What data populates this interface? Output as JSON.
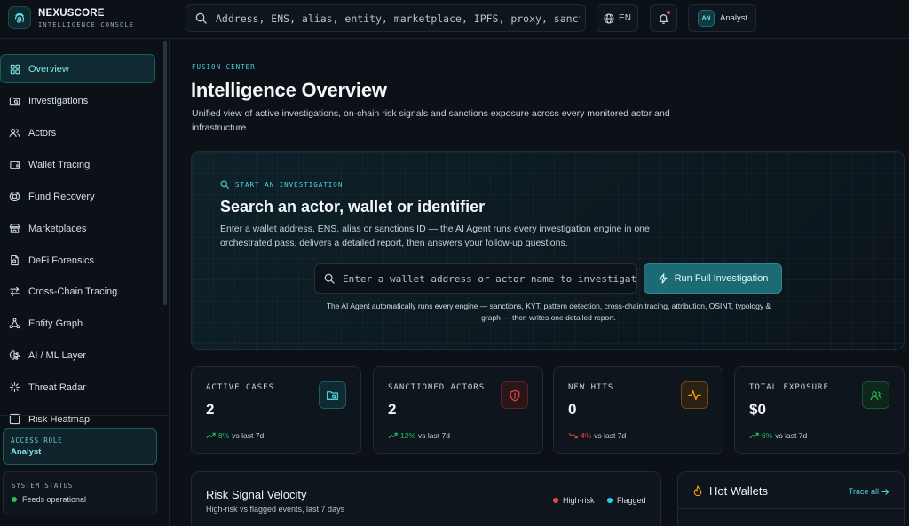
{
  "app": {
    "name": "NEXUSCORE",
    "subtitle": "INTELLIGENCE CONSOLE",
    "search_placeholder": "Address, ENS, alias, entity, marketplace, IPFS, proxy, sanctions ID",
    "language": "EN",
    "user": {
      "initials": "AN",
      "label": "Analyst"
    }
  },
  "sidebar": {
    "items": [
      {
        "label": "Overview",
        "icon": "grid-icon",
        "active": true
      },
      {
        "label": "Investigations",
        "icon": "folder-search-icon"
      },
      {
        "label": "Actors",
        "icon": "users-icon"
      },
      {
        "label": "Wallet Tracing",
        "icon": "wallet-icon"
      },
      {
        "label": "Fund Recovery",
        "icon": "lifebuoy-icon"
      },
      {
        "label": "Marketplaces",
        "icon": "store-icon"
      },
      {
        "label": "DeFi Forensics",
        "icon": "file-search-icon"
      },
      {
        "label": "Cross-Chain Tracing",
        "icon": "arrows-exchange-icon"
      },
      {
        "label": "Entity Graph",
        "icon": "network-icon"
      },
      {
        "label": "AI / ML Layer",
        "icon": "brain-icon"
      },
      {
        "label": "Threat Radar",
        "icon": "radar-icon"
      },
      {
        "label": "Risk Heatmap",
        "icon": "heatmap-icon"
      }
    ],
    "access_role": {
      "label": "ACCESS ROLE",
      "value": "Analyst"
    },
    "system_status": {
      "label": "SYSTEM STATUS",
      "value": "Feeds operational"
    }
  },
  "header": {
    "eyebrow": "FUSION CENTER",
    "title": "Intelligence Overview",
    "description": "Unified view of active investigations, on-chain risk signals and sanctions exposure across every monitored actor and infrastructure."
  },
  "hero": {
    "eyebrow": "START AN INVESTIGATION",
    "title": "Search an actor, wallet or identifier",
    "description": "Enter a wallet address, ENS, alias or sanctions ID — the AI Agent runs every investigation engine in one orchestrated pass, delivers a detailed report, then answers your follow-up questions.",
    "input_placeholder": "Enter a wallet address or actor name to investigate…",
    "button_label": "Run Full Investigation",
    "note": "The AI Agent automatically runs every engine — sanctions, KYT, pattern detection, cross-chain tracing, attribution, OSINT, typology & graph — then writes one detailed report."
  },
  "stats": [
    {
      "label": "ACTIVE CASES",
      "value": "2",
      "delta": "8%",
      "delta_suffix": "vs last 7d",
      "trend": "up",
      "icon": "folder-search-icon",
      "accent": "#4fd1dc"
    },
    {
      "label": "SANCTIONED ACTORS",
      "value": "2",
      "delta": "12%",
      "delta_suffix": "vs last 7d",
      "trend": "up",
      "icon": "shield-alert-icon",
      "accent": "#ef4444"
    },
    {
      "label": "NEW HITS",
      "value": "0",
      "delta": "4%",
      "delta_suffix": "vs last 7d",
      "trend": "down",
      "icon": "activity-icon",
      "accent": "#f59e0b"
    },
    {
      "label": "TOTAL EXPOSURE",
      "value": "$0",
      "delta": "6%",
      "delta_suffix": "vs last 7d",
      "trend": "up",
      "icon": "users-icon",
      "accent": "#22c55e"
    }
  ],
  "risk_panel": {
    "title": "Risk Signal Velocity",
    "subtitle": "High-risk vs flagged events, last 7 days",
    "legend": [
      {
        "label": "High-risk",
        "color": "#ef4444"
      },
      {
        "label": "Flagged",
        "color": "#22d3ee"
      }
    ]
  },
  "hot_wallets": {
    "title": "Hot Wallets",
    "link": "Trace all"
  }
}
